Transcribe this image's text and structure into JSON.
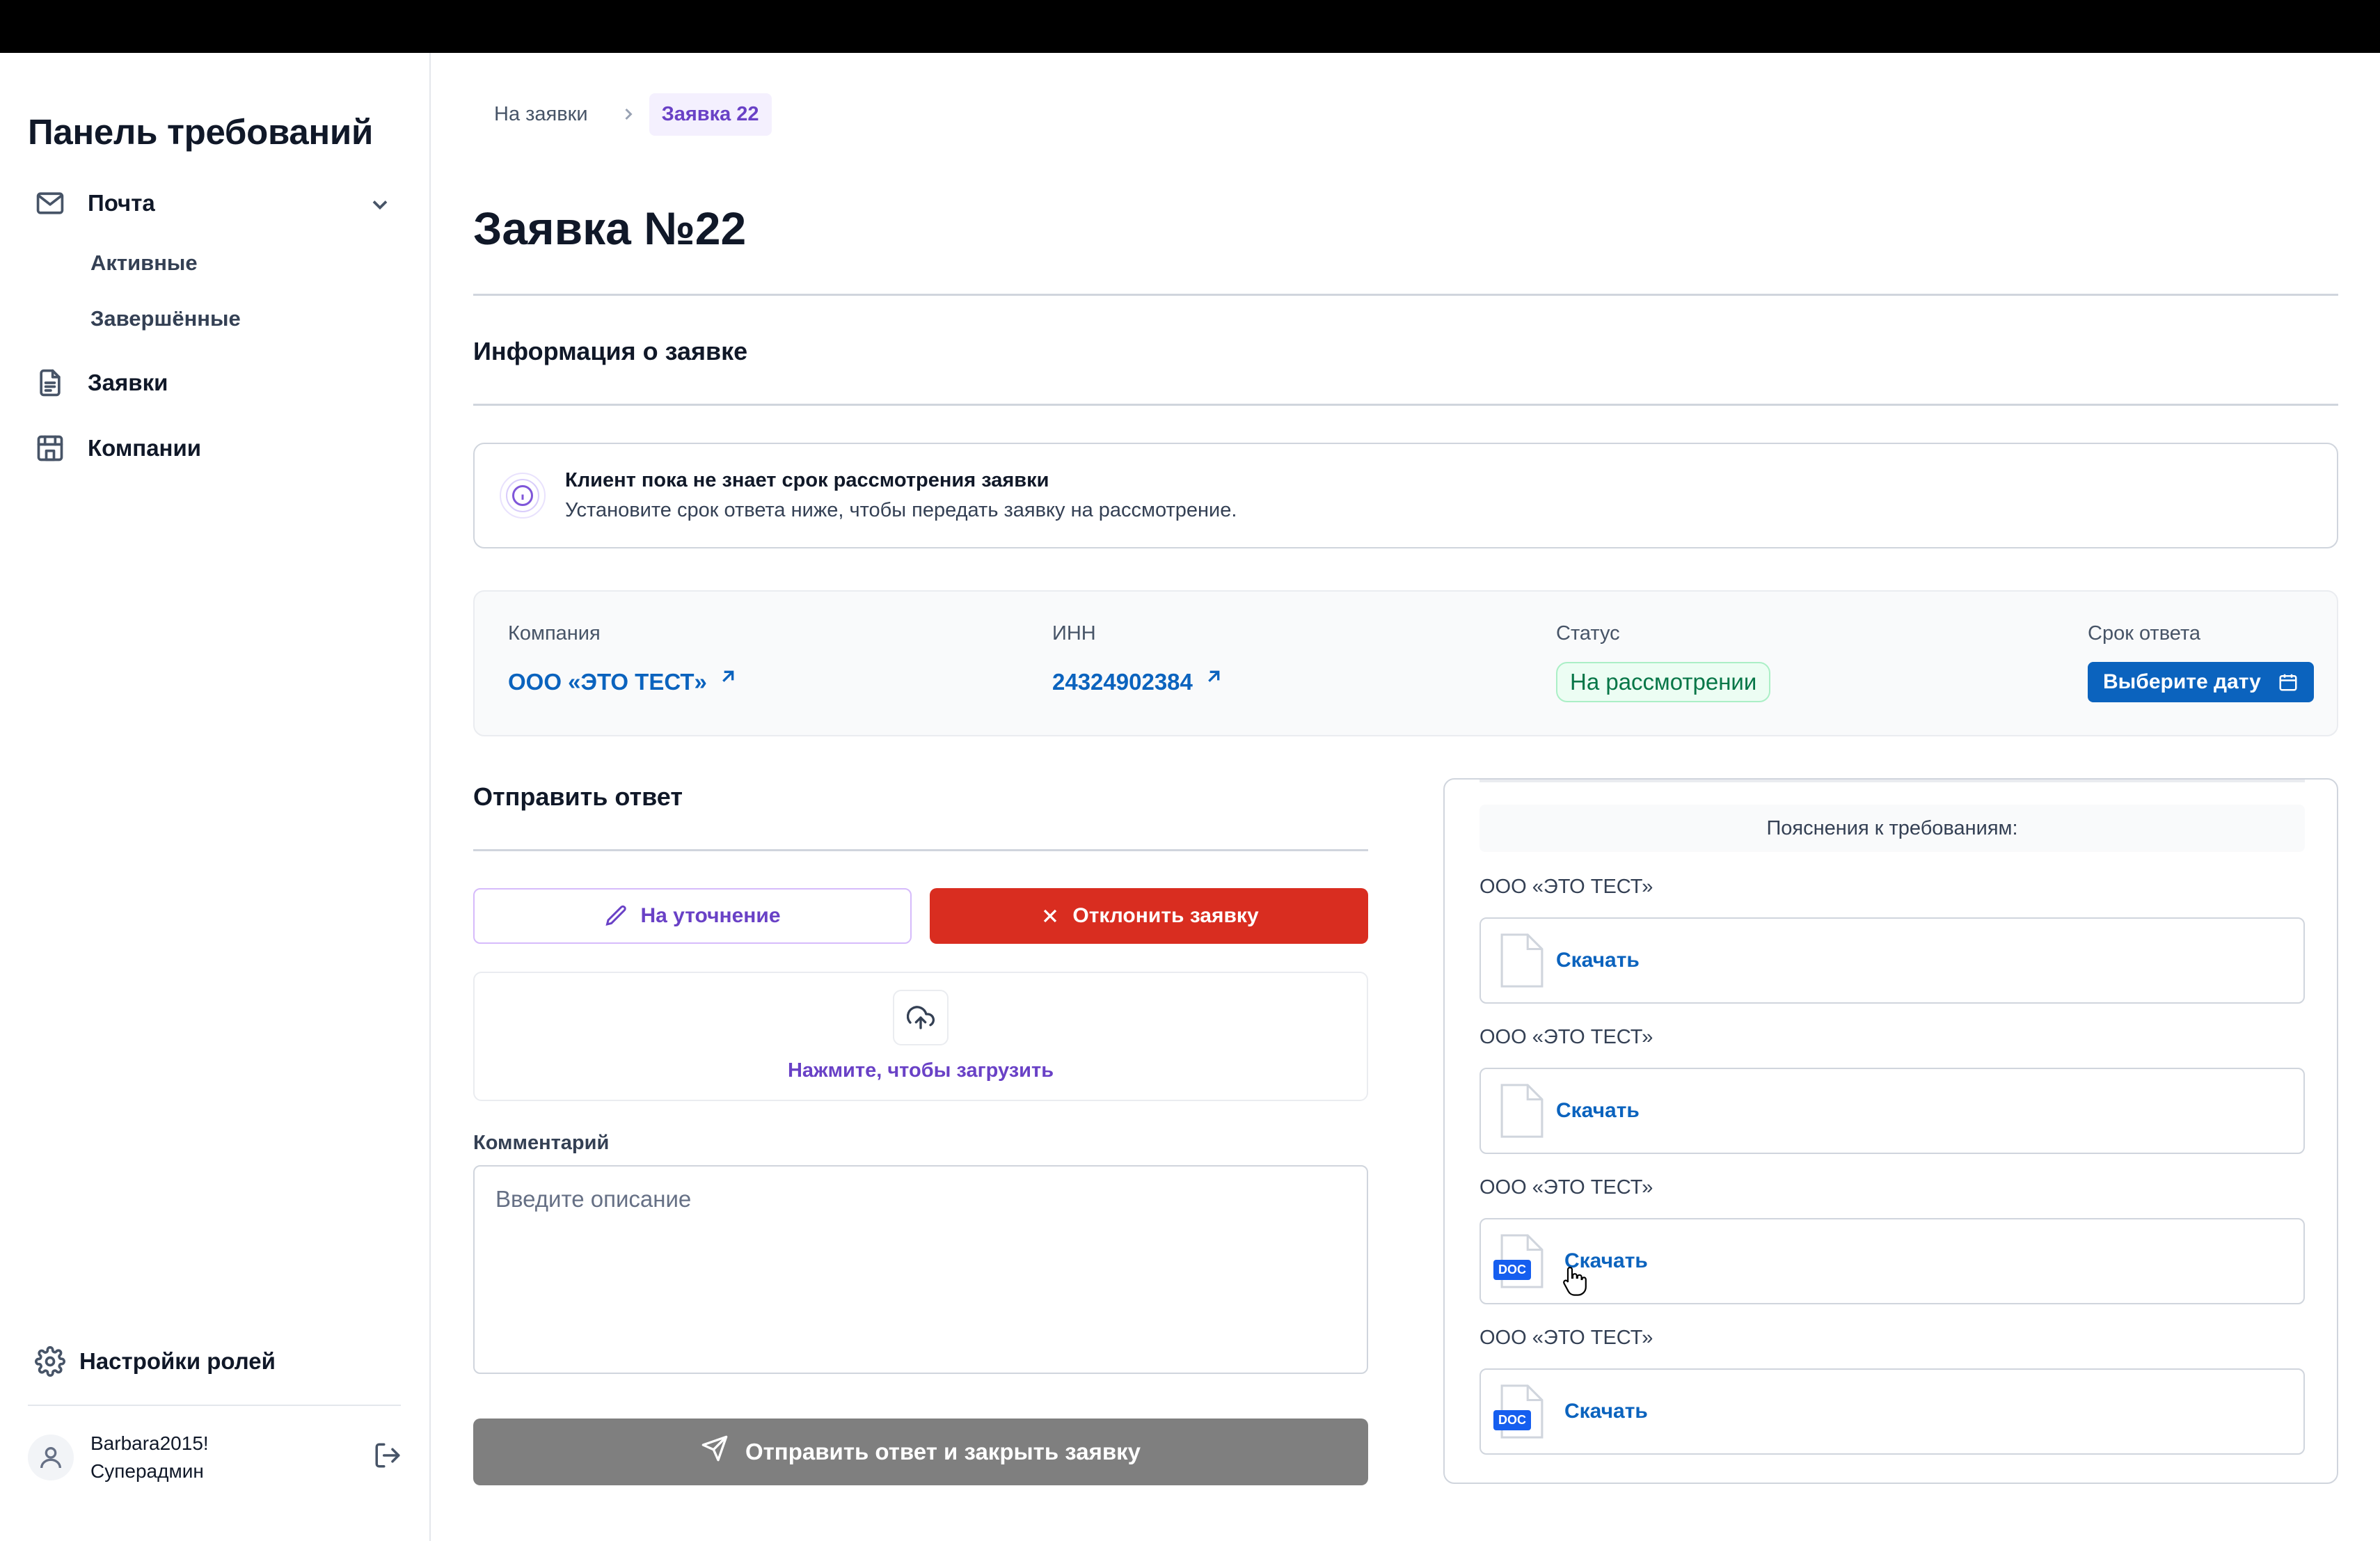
{
  "sidebar": {
    "app_title": "Панель требований",
    "mail_label": "Почта",
    "mail_sub": [
      "Активные",
      "Завершённые"
    ],
    "requests_label": "Заявки",
    "companies_label": "Компании",
    "roles_label": "Настройки ролей",
    "user_name": "Barbara2015!",
    "user_role": "Суперадмин"
  },
  "breadcrumb": {
    "back": "На заявки",
    "current": "Заявка 22"
  },
  "page_title": "Заявка №22",
  "info_section_title": "Информация о заявке",
  "alert": {
    "title": "Клиент пока не знает срок рассмотрения заявки",
    "description": "Установите срок ответа ниже, чтобы передать заявку на рассмотрение."
  },
  "details": {
    "company_label": "Компания",
    "company_value": "ООО «ЭТО ТЕСТ»",
    "inn_label": "ИНН",
    "inn_value": "24324902384",
    "status_label": "Статус",
    "status_value": "На рассмотрении",
    "deadline_label": "Срок ответа",
    "deadline_button": "Выберите дату"
  },
  "reply": {
    "title": "Отправить ответ",
    "clarify_button": "На уточнение",
    "reject_button": "Отклонить заявку",
    "upload_text": "Нажмите, чтобы загрузить",
    "comment_label": "Комментарий",
    "comment_placeholder": "Введите описание",
    "submit_button": "Отправить ответ и закрыть заявку"
  },
  "explanations": {
    "header": "Пояснения к требованиям:",
    "items": [
      {
        "company": "ООО «ЭТО ТЕСТ»",
        "link": "Скачать",
        "type": "file"
      },
      {
        "company": "ООО «ЭТО ТЕСТ»",
        "link": "Скачать",
        "type": "file"
      },
      {
        "company": "ООО «ЭТО ТЕСТ»",
        "link": "Скачать",
        "type": "DOC"
      },
      {
        "company": "ООО «ЭТО ТЕСТ»",
        "link": "Скачать",
        "type": "DOC"
      }
    ]
  },
  "icons": {
    "mail": "mail-icon",
    "chevron": "chevron-down-icon",
    "requests": "document-icon",
    "companies": "building-icon",
    "settings": "gear-icon",
    "user": "user-icon",
    "logout": "logout-icon",
    "info": "info-icon",
    "external": "arrow-up-right-icon",
    "calendar": "calendar-icon",
    "pencil": "pencil-icon",
    "close": "x-icon",
    "upload": "upload-cloud-icon",
    "send": "send-icon",
    "file": "file-icon"
  },
  "colors": {
    "accent_purple": "#6941c6",
    "link_blue": "#0b63be",
    "danger_red": "#d92d20",
    "status_green": "#067647",
    "disabled_gray": "#7f7f7f"
  }
}
